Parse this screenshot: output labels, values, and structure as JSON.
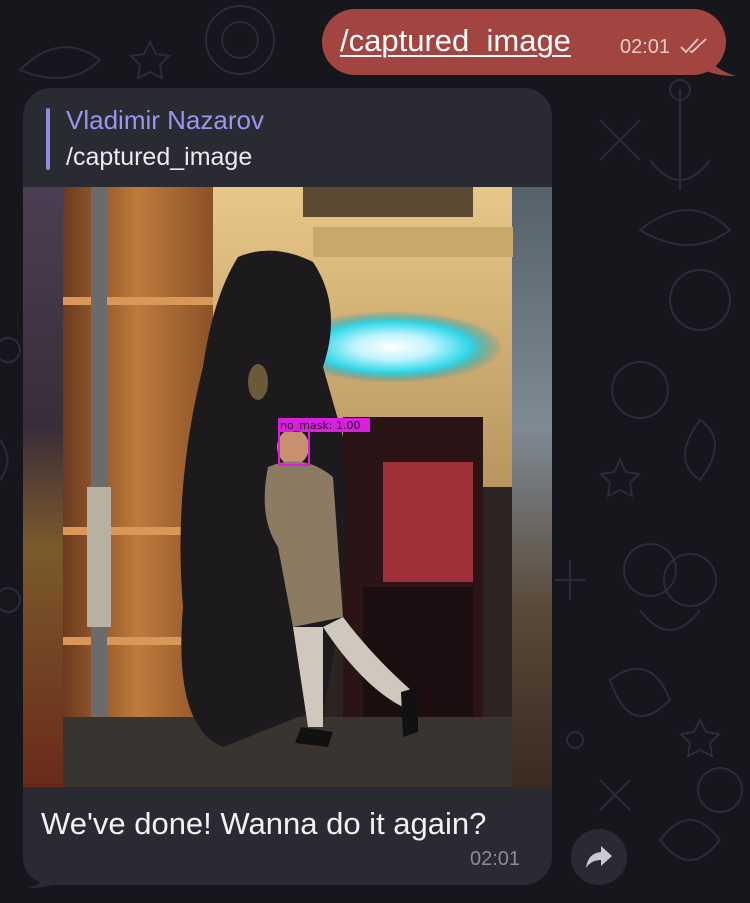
{
  "outgoing_message": {
    "text": "/captured_image",
    "time": "02:01",
    "status": "double-check-icon"
  },
  "incoming_message": {
    "reply": {
      "sender": "Vladimir Nazarov",
      "quoted_text": "/captured_image"
    },
    "image": {
      "detection_label": "no_mask: 1.00"
    },
    "caption": "We've done! Wanna do it again?",
    "time": "02:01"
  },
  "actions": {
    "share_icon": "share-arrow-icon"
  },
  "colors": {
    "background": "#16161d",
    "outgoing_bubble": "#a2443f",
    "incoming_bubble": "#2a2a33",
    "reply_accent": "#8f8be7",
    "detection_box": "#d91fe0"
  }
}
